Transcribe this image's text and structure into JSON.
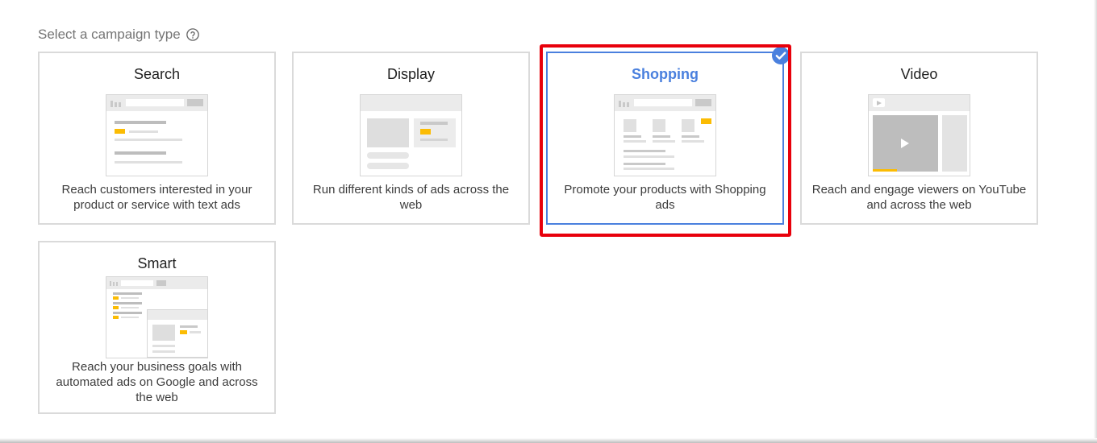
{
  "heading": {
    "label": "Select a campaign type",
    "help_icon": "help-circle-icon"
  },
  "cards": {
    "search": {
      "title": "Search",
      "description": "Reach customers interested in your product or service with text ads"
    },
    "display": {
      "title": "Display",
      "description": "Run different kinds of ads across the web"
    },
    "shopping": {
      "title": "Shopping",
      "description": "Promote your products with Shopping ads",
      "selected": true
    },
    "video": {
      "title": "Video",
      "description": "Reach and engage viewers on YouTube and across the web"
    },
    "smart": {
      "title": "Smart",
      "description": "Reach your business goals with automated ads on Google and across the web"
    }
  },
  "colors": {
    "selected_accent": "#4a80de",
    "highlight_red": "#e8000b",
    "ad_yellow": "#fbbc04",
    "card_border": "#dadada"
  }
}
